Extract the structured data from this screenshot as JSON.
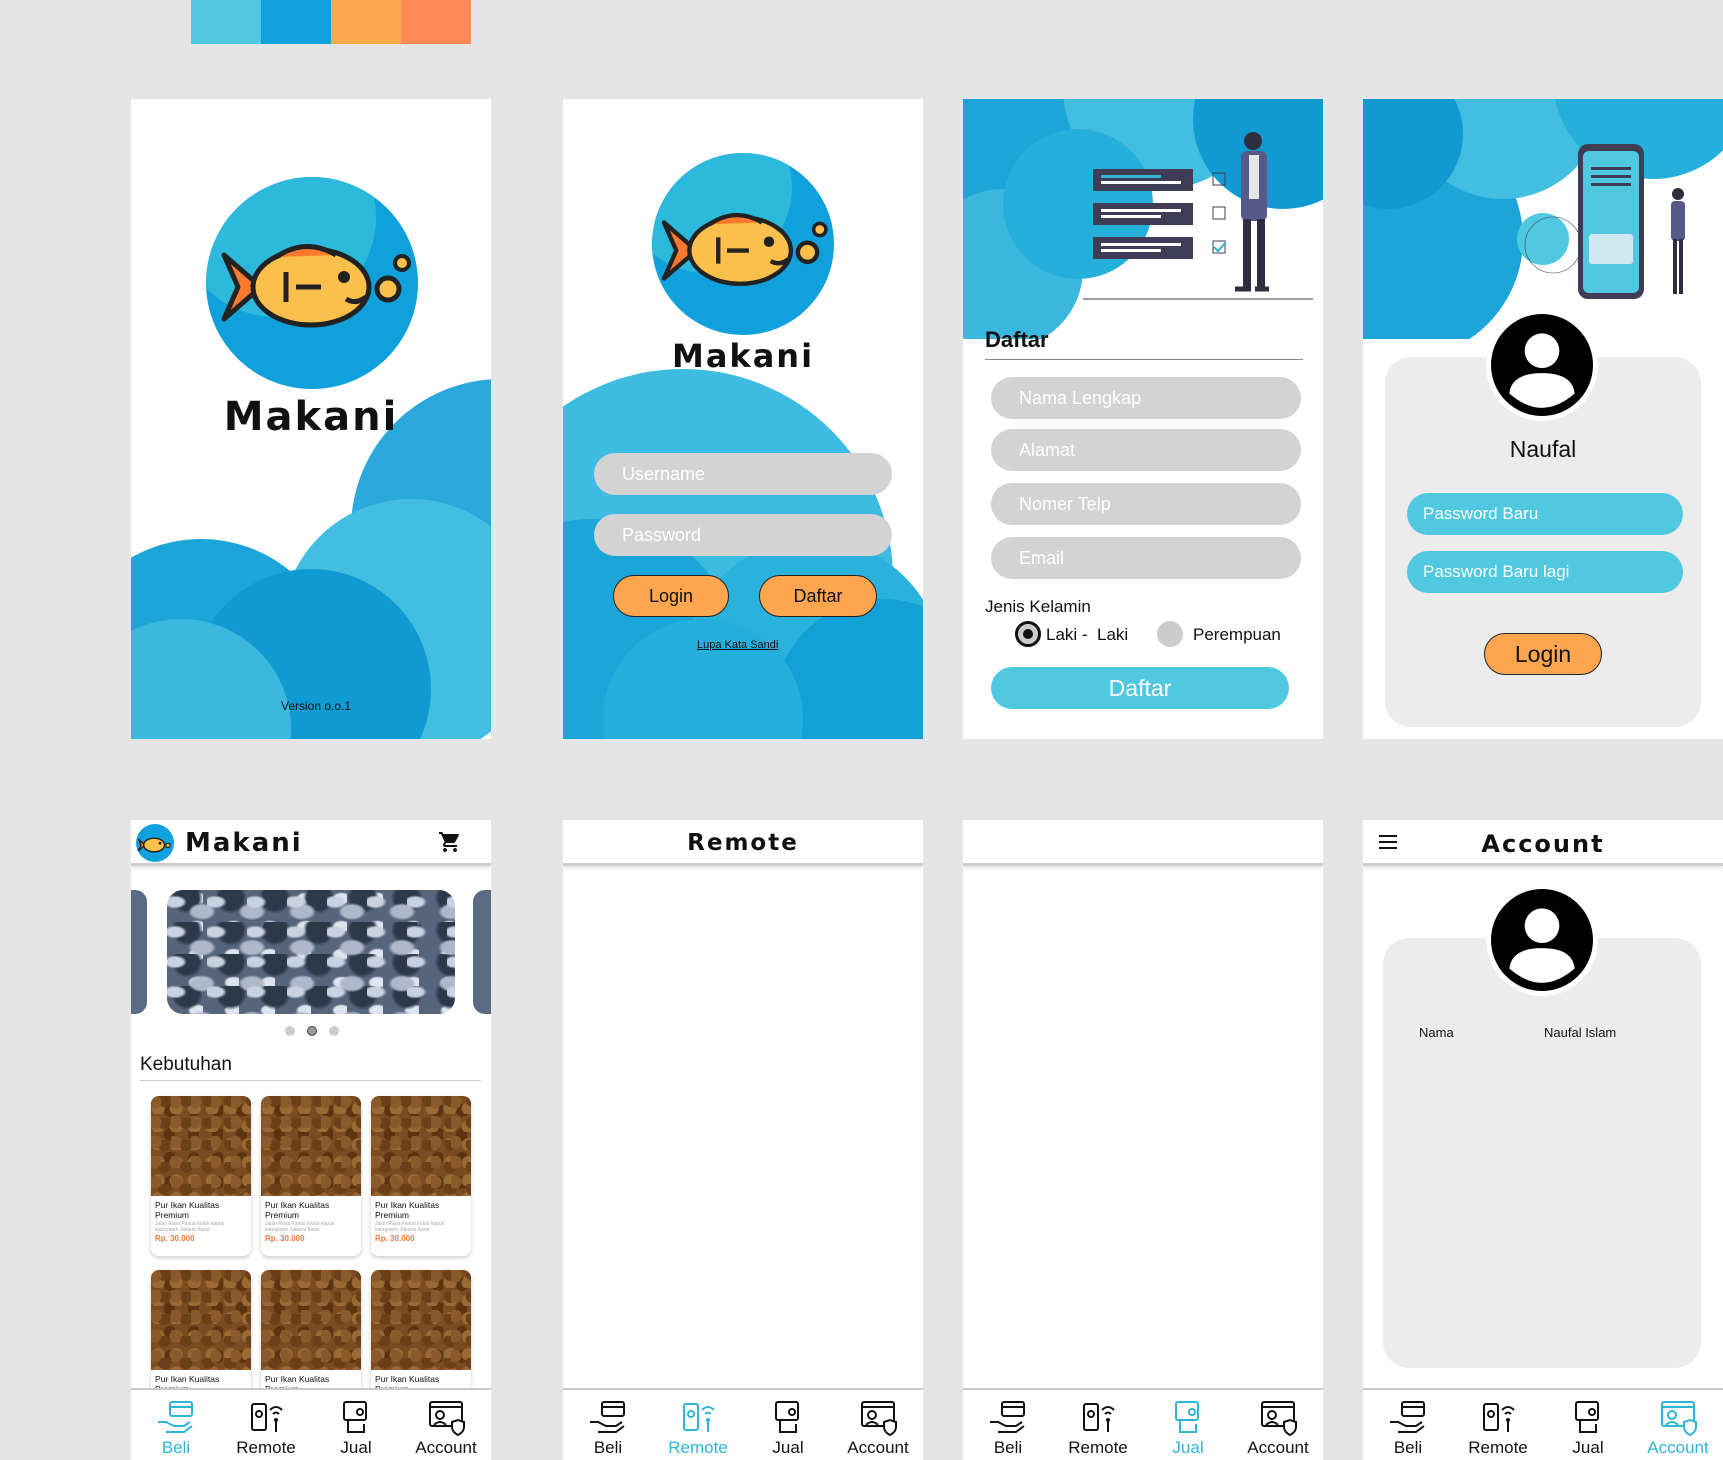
{
  "palette": [
    "#50c8e0",
    "#10a0dc",
    "#fdaa4f",
    "#ff8a55"
  ],
  "splash": {
    "brand": "Makani",
    "version": "Version o.o.1"
  },
  "login": {
    "brand": "Makani",
    "username_placeholder": "Username",
    "password_placeholder": "Password",
    "login_label": "Login",
    "daftar_label": "Daftar",
    "forgot_link": "Lupa Kata Sandi"
  },
  "register": {
    "title": "Daftar",
    "fields": [
      "Nama Lengkap",
      "Alamat",
      "Nomer Telp",
      "Email"
    ],
    "gender_label": "Jenis Kelamin",
    "gender_male": "Laki -  Laki",
    "gender_female": "Perempuan",
    "submit_label": "Daftar"
  },
  "reset": {
    "user_name": "Naufal",
    "new_password": "Password Baru",
    "new_password_again": "Password Baru lagi",
    "login_label": "Login"
  },
  "home": {
    "brand": "Makani",
    "section_title": "Kebutuhan",
    "products": [
      {
        "name": "Pur Ikan Kualitas Premium",
        "address": "Jalan Raya Pantai Indah kapuk kabupaten Jakarta Barat",
        "price": "Rp. 30.000"
      },
      {
        "name": "Pur Ikan Kualitas Premium",
        "address": "Jalan Raya Pantai Indah kapuk kabupaten Jakarta Barat",
        "price": "Rp. 30.000"
      },
      {
        "name": "Pur Ikan Kualitas Premium",
        "address": "Jalan Raya Pantai Indah kapuk kabupaten Jakarta Barat",
        "price": "Rp. 30.000"
      },
      {
        "name": "Pur Ikan Kualitas Premium"
      },
      {
        "name": "Pur Ikan Kualitas Premium"
      },
      {
        "name": "Pur Ikan Kualitas Premium"
      }
    ]
  },
  "remote": {
    "title": "Remote"
  },
  "account": {
    "title": "Account",
    "name_label": "Nama",
    "name_value": "Naufal Islam"
  },
  "tabs": [
    "Beli",
    "Remote",
    "Jual",
    "Account"
  ],
  "accent": "#2fb5d6"
}
